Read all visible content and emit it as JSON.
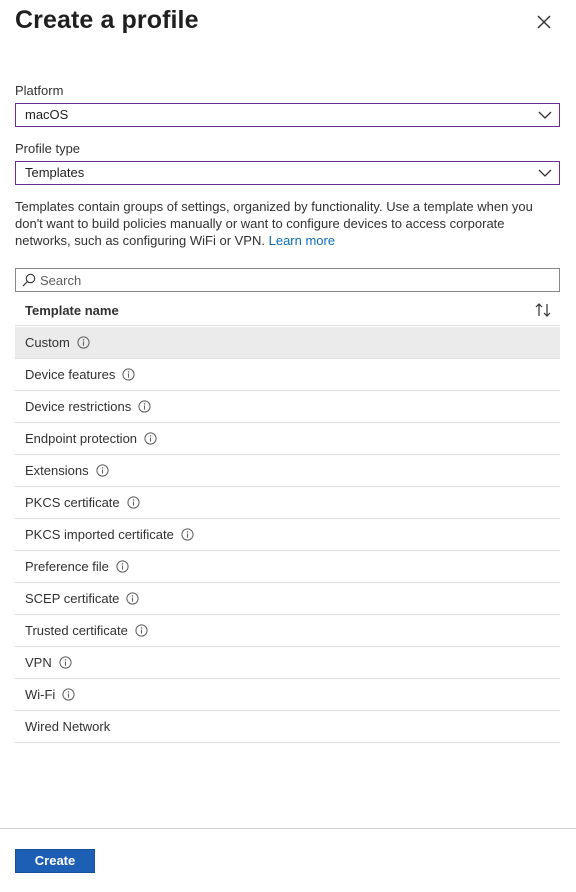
{
  "header": {
    "title": "Create a profile",
    "close_icon": "close-icon"
  },
  "platform": {
    "label": "Platform",
    "value": "macOS"
  },
  "profile_type": {
    "label": "Profile type",
    "value": "Templates"
  },
  "description": {
    "text": "Templates contain groups of settings, organized by functionality. Use a template when you don't want to build policies manually or want to configure devices to access corporate networks, such as configuring WiFi or VPN.",
    "link": "Learn more"
  },
  "search": {
    "placeholder": "Search"
  },
  "table": {
    "header": "Template name",
    "rows": [
      {
        "label": "Custom",
        "info": true,
        "selected": true
      },
      {
        "label": "Device features",
        "info": true
      },
      {
        "label": "Device restrictions",
        "info": true
      },
      {
        "label": "Endpoint protection",
        "info": true
      },
      {
        "label": "Extensions",
        "info": true
      },
      {
        "label": "PKCS certificate",
        "info": true
      },
      {
        "label": "PKCS imported certificate",
        "info": true
      },
      {
        "label": "Preference file",
        "info": true
      },
      {
        "label": "SCEP certificate",
        "info": true
      },
      {
        "label": "Trusted certificate",
        "info": true
      },
      {
        "label": "VPN",
        "info": true
      },
      {
        "label": "Wi-Fi",
        "info": true
      },
      {
        "label": "Wired Network",
        "info": false
      }
    ]
  },
  "footer": {
    "create_label": "Create"
  },
  "colors": {
    "accent_border": "#6b2c91",
    "primary_button": "#1d5fb5",
    "link": "#0f6cbd",
    "selected_row": "#ebebeb"
  }
}
